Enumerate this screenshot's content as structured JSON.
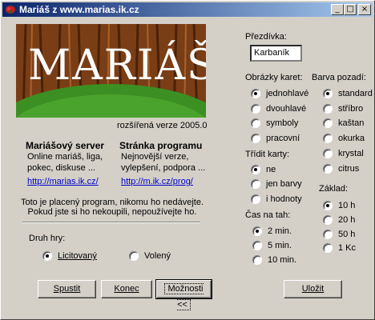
{
  "window": {
    "title": "Mariáš z www.marias.ik.cz",
    "controls": {
      "minimize": "_",
      "maximize": "□",
      "close": "×"
    }
  },
  "banner": {
    "logo_text": "MARIÁŠ",
    "version": "rozšířená verze 2005.0"
  },
  "server": {
    "heading": "Mariášový server",
    "desc_line1": "Online mariáš, liga,",
    "desc_line2": "pokec, diskuse ...",
    "link": "http://marias.ik.cz/"
  },
  "program": {
    "heading": "Stránka programu",
    "desc_line1": "Nejnovější verze,",
    "desc_line2": "vylepšení, podpora ...",
    "link": "http://m.ik.cz/prog/"
  },
  "notice": {
    "line1": "Toto je placený program, nikomu ho nedávejte.",
    "line2": "Pokud jste si ho nekoupili, nepoužívejte ho."
  },
  "game_type": {
    "label": "Druh hry:",
    "options": [
      "Licitovaný",
      "Volený"
    ],
    "selected": "Licitovaný"
  },
  "buttons": {
    "start": "Spustit",
    "end": "Konec",
    "options": "Možnosti <<",
    "save": "Uložit"
  },
  "nickname": {
    "label": "Přezdívka:",
    "value": "Karbaník"
  },
  "card_images": {
    "label": "Obrázky karet:",
    "options": [
      "jednohlavé",
      "dvouhlavé",
      "symboly",
      "pracovní"
    ],
    "selected": "jednohlavé"
  },
  "background_color": {
    "label": "Barva pozadí:",
    "options": [
      "standard",
      "stříbro",
      "kaštan",
      "okurka",
      "krystal",
      "citrus"
    ],
    "selected": "standard"
  },
  "sort_cards": {
    "label": "Třídit karty:",
    "options": [
      "ne",
      "jen barvy",
      "i hodnoty"
    ],
    "selected": "ne"
  },
  "turn_time": {
    "label": "Čas na tah:",
    "options": [
      "2 min.",
      "5 min.",
      "10 min."
    ],
    "selected": "2 min."
  },
  "base": {
    "label": "Základ:",
    "options": [
      "10 h",
      "20 h",
      "50 h",
      "1 Kc"
    ],
    "selected": "10 h"
  },
  "colors": {
    "title_bar": "#0a246a",
    "link": "#0000cc",
    "window_bg": "#d4d0c8",
    "banner_green": "#3c8f23"
  }
}
